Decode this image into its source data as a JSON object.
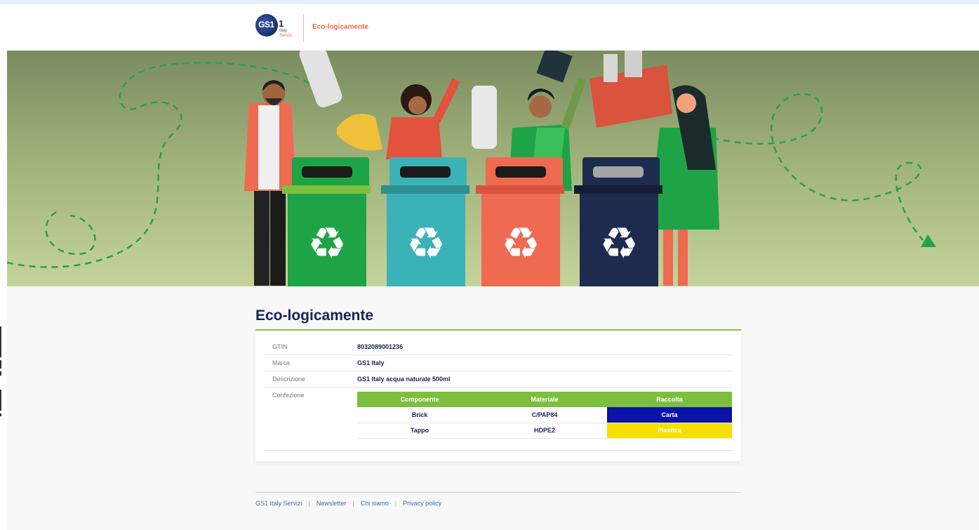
{
  "header": {
    "logo_mark": "GS1",
    "logo_one": "1",
    "logo_sub1": "Italy",
    "logo_sub2": "Servizi",
    "title": "Eco-logicamente"
  },
  "hero": {
    "bins": [
      {
        "color": "#1ea446",
        "lid": "#7dbf3f"
      },
      {
        "color": "#3bb3b6",
        "lid": "#2f8f93"
      },
      {
        "color": "#ee6a50",
        "lid": "#d9533d"
      },
      {
        "color": "#1d2b4f",
        "lid": "#141d35"
      }
    ],
    "path_color": "#22a34a"
  },
  "main": {
    "title": "Eco-logicamente",
    "rows": [
      {
        "label": "GTIN",
        "value": "8032089001236"
      },
      {
        "label": "Marca",
        "value": "GS1 Italy"
      },
      {
        "label": "Descrizione",
        "value": "GS1 Italy acqua naturale 500ml"
      },
      {
        "label": "Confezione",
        "value": ""
      }
    ],
    "packaging": {
      "headers": [
        "Componente",
        "Materiale",
        "Raccolta"
      ],
      "rows": [
        {
          "componente": "Brick",
          "materiale": "C/PAP84",
          "raccolta": "Carta"
        },
        {
          "componente": "Tappo",
          "materiale": "HDPE2",
          "raccolta": "Plastica"
        }
      ]
    }
  },
  "footer": {
    "links": [
      "GS1 Italy Servizi",
      "Newsletter",
      "Chi siamo",
      "Privacy policy"
    ]
  },
  "colors": {
    "accent": "#7cbf3f",
    "brand_navy": "#17245a",
    "brand_orange": "#ea6b45",
    "carta": "#0a13a6",
    "plastica": "#f5e000"
  }
}
